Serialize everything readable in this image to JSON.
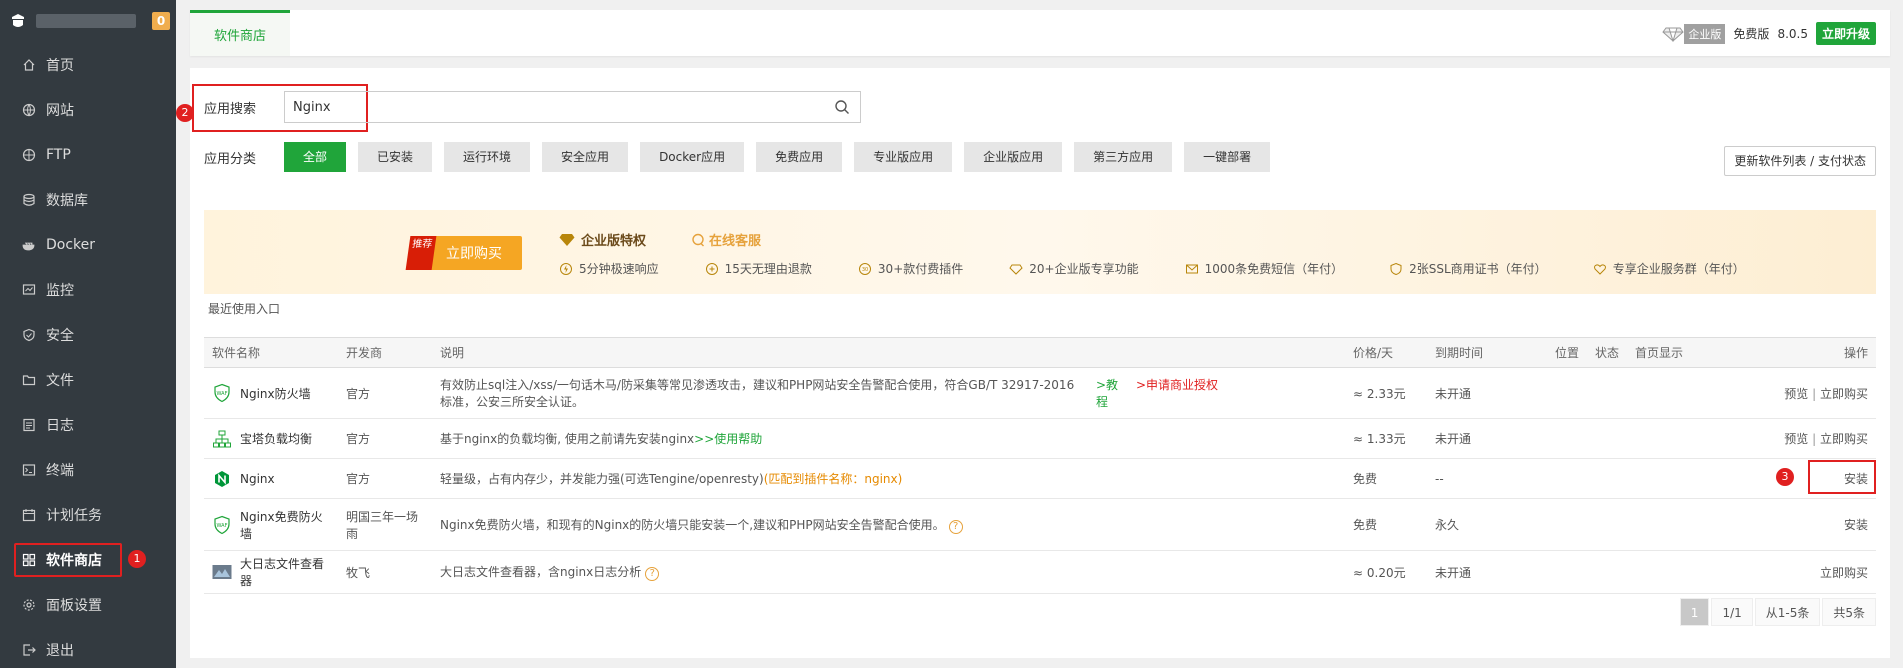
{
  "sidebar": {
    "badge": "0",
    "items": [
      {
        "label": "首页",
        "icon": "home-icon"
      },
      {
        "label": "网站",
        "icon": "globe-icon"
      },
      {
        "label": "FTP",
        "icon": "ftp-icon"
      },
      {
        "label": "数据库",
        "icon": "database-icon"
      },
      {
        "label": "Docker",
        "icon": "docker-icon"
      },
      {
        "label": "监控",
        "icon": "monitor-icon"
      },
      {
        "label": "安全",
        "icon": "shield-icon"
      },
      {
        "label": "文件",
        "icon": "folder-icon"
      },
      {
        "label": "日志",
        "icon": "log-icon"
      },
      {
        "label": "终端",
        "icon": "terminal-icon"
      },
      {
        "label": "计划任务",
        "icon": "calendar-icon"
      },
      {
        "label": "软件商店",
        "icon": "grid-icon"
      },
      {
        "label": "面板设置",
        "icon": "gear-icon"
      },
      {
        "label": "退出",
        "icon": "logout-icon"
      }
    ],
    "active_marker": "1"
  },
  "header": {
    "tab": "软件商店",
    "edition_badge": "企业版",
    "free_label": "免费版",
    "version": "8.0.5",
    "upgrade_label": "立即升级"
  },
  "search": {
    "label": "应用搜索",
    "value": "Nginx",
    "marker": "2"
  },
  "categories": {
    "label": "应用分类",
    "items": [
      "全部",
      "已安装",
      "运行环境",
      "安全应用",
      "Docker应用",
      "免费应用",
      "专业版应用",
      "企业版应用",
      "第三方应用",
      "一键部署"
    ],
    "refresh_label": "更新软件列表 / 支付状态"
  },
  "banner": {
    "ribbon": "推荐",
    "buy_label": "立即购买",
    "title": "企业版特权",
    "service": "在线客服",
    "features": [
      "5分钟极速响应",
      "15天无理由退款",
      "30+款付费插件",
      "20+企业版专享功能",
      "1000条免费短信（年付）",
      "2张SSL商用证书（年付）",
      "专享企业服务群（年付）"
    ]
  },
  "recent_label": "最近使用入口",
  "table": {
    "headers": [
      "软件名称",
      "开发商",
      "说明",
      "价格/天",
      "到期时间",
      "位置",
      "状态",
      "首页显示",
      "操作"
    ],
    "rows": [
      {
        "name": "Nginx防火墙",
        "dev": "官方",
        "desc": "有效防止sql注入/xss/一句话木马/防采集等常见渗透攻击，建议和PHP网站安全告警配合使用，符合GB/T 32917-2016标准，公安三所安全认证。",
        "link1": ">教程",
        "link2": ">申请商业授权",
        "price": "≈ 2.33元",
        "expire": "未开通",
        "op1": "预览",
        "sep": "|",
        "op2": "立即购买"
      },
      {
        "name": "宝塔负载均衡",
        "dev": "官方",
        "desc": "基于nginx的负载均衡, 使用之前请先安装nginx",
        "link1": ">>使用帮助",
        "price": "≈ 1.33元",
        "expire": "未开通",
        "op1": "预览",
        "sep": "|",
        "op2": "立即购买"
      },
      {
        "name": "Nginx",
        "dev": "官方",
        "desc": "轻量级，占有内存少，并发能力强(可选Tengine/openresty)",
        "match": "(匹配到插件名称：nginx)",
        "price": "免费",
        "expire": "--",
        "op1": "安装",
        "marker": "3"
      },
      {
        "name": "Nginx免费防火墙",
        "dev": "明国三年一场雨",
        "desc": "Nginx免费防火墙，和现有的Nginx的防火墙只能安装一个,建议和PHP网站安全告警配合使用。",
        "help": "?",
        "price": "免费",
        "expire": "永久",
        "op1": "安装"
      },
      {
        "name": "大日志文件查看器",
        "dev": "牧飞",
        "desc": "大日志文件查看器，含nginx日志分析",
        "help": "?",
        "price": "≈ 0.20元",
        "expire": "未开通",
        "op1": "立即购买"
      }
    ]
  },
  "pager": {
    "current": "1",
    "pages": "1/1",
    "range": "从1-5条",
    "total": "共5条"
  },
  "colors": {
    "accent": "#20a53a",
    "sidebar": "#333a40",
    "highlight": "#e02020",
    "price": "#e68a00"
  }
}
